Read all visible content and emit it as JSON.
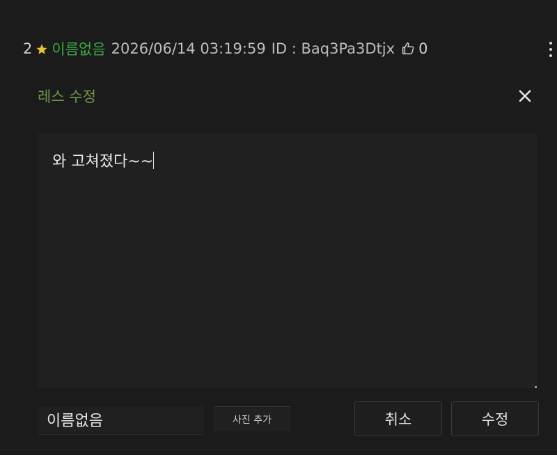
{
  "post": {
    "number": "2",
    "author": "이름없음",
    "date": "2026/06/14 03:19:59",
    "id_label": "ID : Baq3Pa3Dtjx",
    "likes": "0"
  },
  "dialog": {
    "title": "레스 수정",
    "body_text": "와 고쳐졌다~~"
  },
  "form": {
    "name_value": "이름없음",
    "photo_button_label": "사진 추가",
    "cancel_label": "취소",
    "submit_label": "수정"
  },
  "colors": {
    "background": "#1b1b1b",
    "author": "#39a845",
    "dialog_title": "#6d9a4a",
    "star": "#e6c23a"
  },
  "icons": {
    "star": "star-icon",
    "like": "thumbs-up-icon",
    "menu": "kebab-menu-icon",
    "close": "close-icon"
  }
}
